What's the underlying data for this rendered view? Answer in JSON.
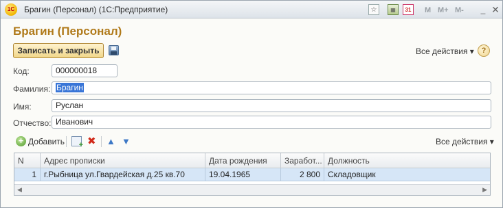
{
  "window": {
    "title": "Брагин (Персонал)  (1С:Предприятие)",
    "logo_text": "1С",
    "buttons": {
      "m": "M",
      "m_plus": "M+",
      "m_minus": "M-",
      "minimize": "_",
      "close": "✕"
    }
  },
  "form": {
    "title": "Брагин (Персонал)",
    "save_close_label": "Записать и закрыть",
    "all_actions_label": "Все действия ▾",
    "help_label": "?"
  },
  "fields": {
    "code": {
      "label": "Код:",
      "value": "000000018"
    },
    "surname": {
      "label": "Фамилия:",
      "value": "Брагин"
    },
    "name": {
      "label": "Имя:",
      "value": "Руслан"
    },
    "patronymic": {
      "label": "Отчество:",
      "value": "Иванович"
    }
  },
  "table_toolbar": {
    "add_label": "Добавить",
    "all_actions_label": "Все действия ▾"
  },
  "table": {
    "columns": [
      "N",
      "Адрес прописки",
      "Дата рождения",
      "Заработ...",
      "Должность"
    ],
    "rows": [
      {
        "n": "1",
        "address": "г.Рыбница ул.Гвардейская д.25 кв.70",
        "birth_date": "19.04.1965",
        "salary": "2 800",
        "position": "Складовщик"
      }
    ]
  },
  "icons": [
    "app-logo-icon",
    "favorite-icon",
    "calculator-icon",
    "calendar-icon",
    "save-disk-icon",
    "help-icon",
    "add-icon",
    "copy-icon",
    "delete-icon",
    "move-up-icon",
    "move-down-icon"
  ],
  "colors": {
    "title_accent": "#b07a1a",
    "selected_row": "#d6e6f7",
    "save_button": "#f1d78a"
  }
}
